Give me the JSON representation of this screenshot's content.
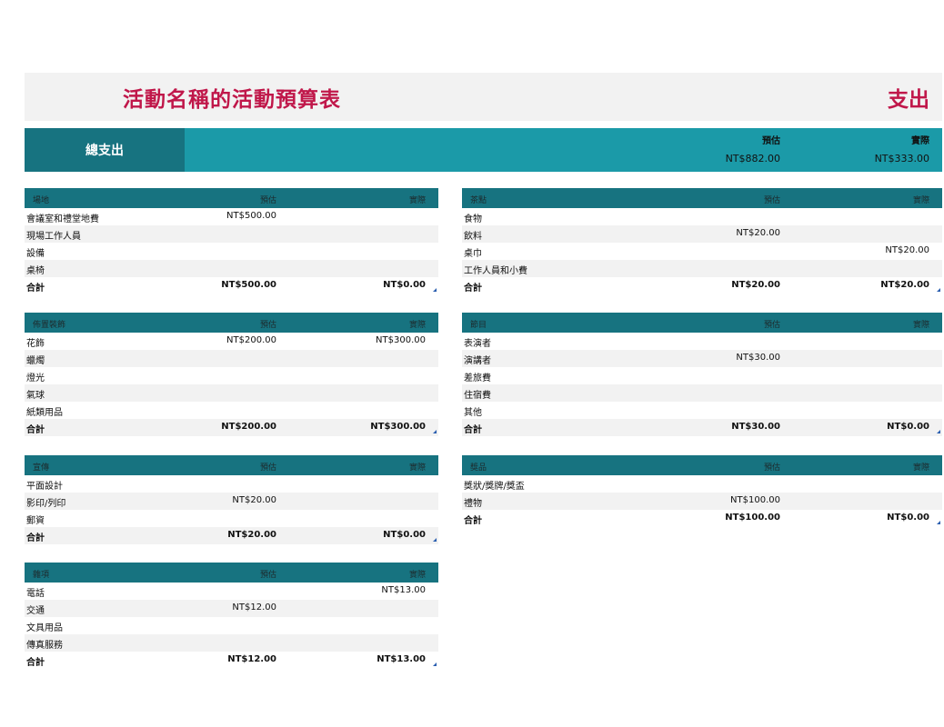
{
  "header": {
    "title": "活動名稱的活動預算表",
    "section": "支出"
  },
  "summary": {
    "label": "總支出",
    "col_est": "預估",
    "col_act": "實際",
    "est": "NT$882.00",
    "act": "NT$333.00"
  },
  "columns": {
    "est": "預估",
    "act": "實際"
  },
  "tables": [
    {
      "name": "場地",
      "rows": [
        [
          "會議室和禮堂地費",
          "NT$500.00",
          ""
        ],
        [
          "現場工作人員",
          "",
          ""
        ],
        [
          "設備",
          "",
          ""
        ],
        [
          "桌椅",
          "",
          ""
        ],
        [
          "合計",
          "NT$500.00",
          "NT$0.00"
        ]
      ]
    },
    {
      "name": "茶點",
      "rows": [
        [
          "食物",
          "",
          ""
        ],
        [
          "飲料",
          "NT$20.00",
          ""
        ],
        [
          "桌巾",
          "",
          "NT$20.00"
        ],
        [
          "工作人員和小費",
          "",
          ""
        ],
        [
          "合計",
          "NT$20.00",
          "NT$20.00"
        ]
      ]
    },
    {
      "name": "佈置裝飾",
      "rows": [
        [
          "花飾",
          "NT$200.00",
          "NT$300.00"
        ],
        [
          "蠟燭",
          "",
          ""
        ],
        [
          "燈光",
          "",
          ""
        ],
        [
          "氣球",
          "",
          ""
        ],
        [
          "紙類用品",
          "",
          ""
        ],
        [
          "合計",
          "NT$200.00",
          "NT$300.00"
        ]
      ]
    },
    {
      "name": "節目",
      "rows": [
        [
          "表演者",
          "",
          ""
        ],
        [
          "演講者",
          "NT$30.00",
          ""
        ],
        [
          "差旅費",
          "",
          ""
        ],
        [
          "住宿費",
          "",
          ""
        ],
        [
          "其他",
          "",
          ""
        ],
        [
          "合計",
          "NT$30.00",
          "NT$0.00"
        ]
      ]
    },
    {
      "name": "宣傳",
      "rows": [
        [
          "平面設計",
          "",
          ""
        ],
        [
          "影印/列印",
          "NT$20.00",
          ""
        ],
        [
          "郵資",
          "",
          ""
        ],
        [
          "合計",
          "NT$20.00",
          "NT$0.00"
        ]
      ]
    },
    {
      "name": "獎品",
      "rows": [
        [
          "獎狀/獎牌/獎盃",
          "",
          ""
        ],
        [
          "禮物",
          "NT$100.00",
          ""
        ],
        [
          "合計",
          "NT$100.00",
          "NT$0.00"
        ]
      ]
    },
    {
      "name": "雜項",
      "rows": [
        [
          "電話",
          "",
          "NT$13.00"
        ],
        [
          "交通",
          "NT$12.00",
          ""
        ],
        [
          "文具用品",
          "",
          ""
        ],
        [
          "傳真服務",
          "",
          ""
        ],
        [
          "合計",
          "NT$12.00",
          "NT$13.00"
        ]
      ]
    }
  ]
}
